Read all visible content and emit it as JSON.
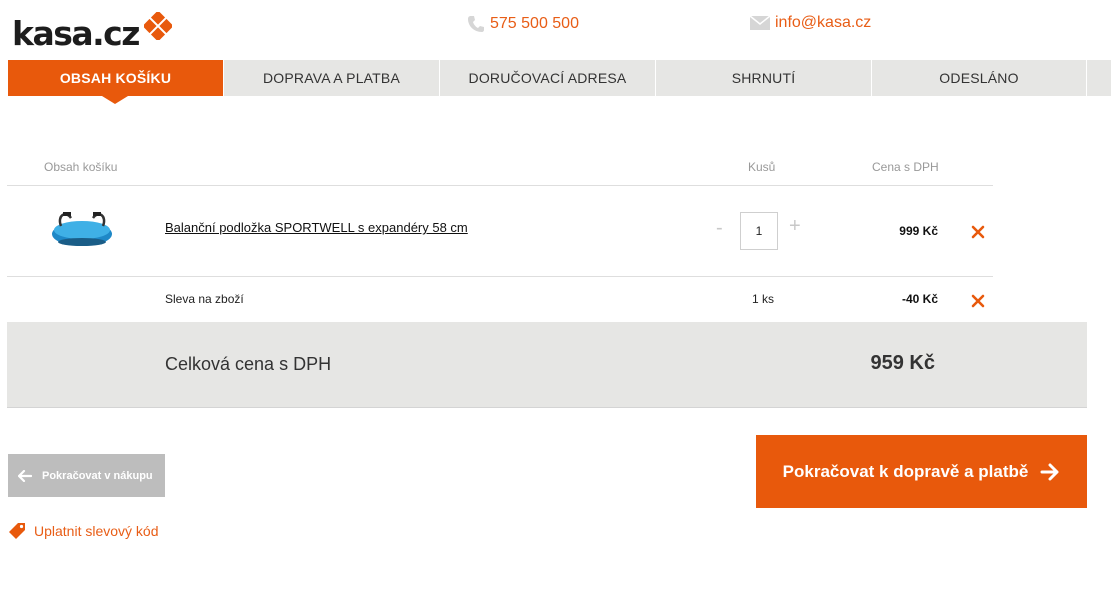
{
  "brand": {
    "logo_text": "kasa.cz",
    "accent": "#e8590c"
  },
  "header": {
    "phone": "575 500 500",
    "email": "info@kasa.cz",
    "phone_icon": "phone-icon",
    "mail_icon": "mail-icon"
  },
  "steps": [
    {
      "label": "Obsah košíku",
      "active": true
    },
    {
      "label": "Doprava a platba",
      "active": false
    },
    {
      "label": "Doručovací adresa",
      "active": false
    },
    {
      "label": "Shrnutí",
      "active": false
    },
    {
      "label": "Odesláno",
      "active": false
    }
  ],
  "cart": {
    "columns": {
      "content": "Obsah košíku",
      "qty": "Kusů",
      "price": "Cena s DPH"
    },
    "items": [
      {
        "name": "Balanční podložka SPORTWELL s expandéry 58 cm",
        "qty": "1",
        "minus": "-",
        "plus": "+",
        "price": "999 Kč"
      }
    ],
    "discount": {
      "label": "Sleva na zboží",
      "qty": "1 ks",
      "price": "-40 Kč"
    },
    "total": {
      "label": "Celková cena s DPH",
      "value": "959 Kč"
    }
  },
  "actions": {
    "back_label": "Pokračovat v nákupu",
    "next_label": "Pokračovat k dopravě a platbě",
    "coupon_label": "Uplatnit slevový kód"
  }
}
